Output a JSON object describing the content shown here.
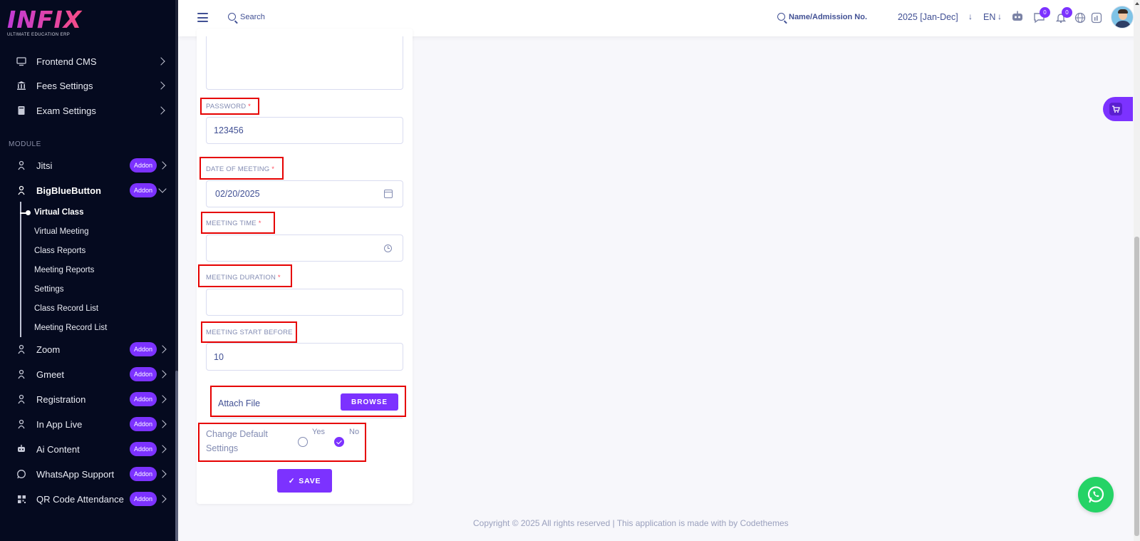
{
  "brand": {
    "name": "INFIX",
    "tagline": "ULTIMATE EDUCATION ERP"
  },
  "sidebar": {
    "items_top": [
      {
        "label": "Frontend CMS",
        "icon": "monitor-icon"
      },
      {
        "label": "Fees Settings",
        "icon": "bank-icon"
      },
      {
        "label": "Exam Settings",
        "icon": "book-icon"
      }
    ],
    "module_heading": "MODULE",
    "modules": [
      {
        "label": "Jitsi",
        "badge": "Addon",
        "icon": "video-icon"
      },
      {
        "label": "BigBlueButton",
        "badge": "Addon",
        "icon": "video-icon"
      },
      {
        "label": "Zoom",
        "badge": "Addon",
        "icon": "video-icon"
      },
      {
        "label": "Gmeet",
        "badge": "Addon",
        "icon": "video-icon"
      },
      {
        "label": "Registration",
        "badge": "Addon",
        "icon": "video-icon"
      },
      {
        "label": "In App Live",
        "badge": "Addon",
        "icon": "video-icon"
      },
      {
        "label": "Ai Content",
        "badge": "Addon",
        "icon": "robot-icon"
      },
      {
        "label": "WhatsApp Support",
        "badge": "Addon",
        "icon": "whatsapp-icon"
      },
      {
        "label": "QR Code Attendance",
        "badge": "Addon",
        "icon": "qr-icon"
      }
    ],
    "submenu": [
      "Virtual Class",
      "Virtual Meeting",
      "Class Reports",
      "Meeting Reports",
      "Settings",
      "Class Record List",
      "Meeting Record List"
    ]
  },
  "header": {
    "search_label": "Search",
    "student_search_label": "Name/Admission No.",
    "session": "2025 [Jan-Dec]",
    "language": "EN",
    "messages_count": "0",
    "notifications_count": "0"
  },
  "form": {
    "password_label": "PASSWORD",
    "password_value": "123456",
    "date_label": "DATE OF MEETING",
    "date_value": "02/20/2025",
    "time_label": "MEETING TIME",
    "time_value": "",
    "duration_label": "MEETING DURATION",
    "duration_value": "",
    "start_before_label": "MEETING START BEFORE",
    "start_before_value": "10",
    "attach_label": "Attach File",
    "browse_label": "BROWSE",
    "change_default_label": "Change Default Settings",
    "yes_label": "Yes",
    "no_label": "No",
    "selected_option": "No",
    "save_label": "SAVE",
    "required_mark": "*"
  },
  "footer": {
    "copyright": "Copyright © 2025 All rights reserved | This application is made with by Codethemes"
  },
  "colors": {
    "accent": "#7c32ff",
    "sidebar_bg": "#050a1f",
    "highlight": "#e60000",
    "whatsapp": "#25d366"
  }
}
